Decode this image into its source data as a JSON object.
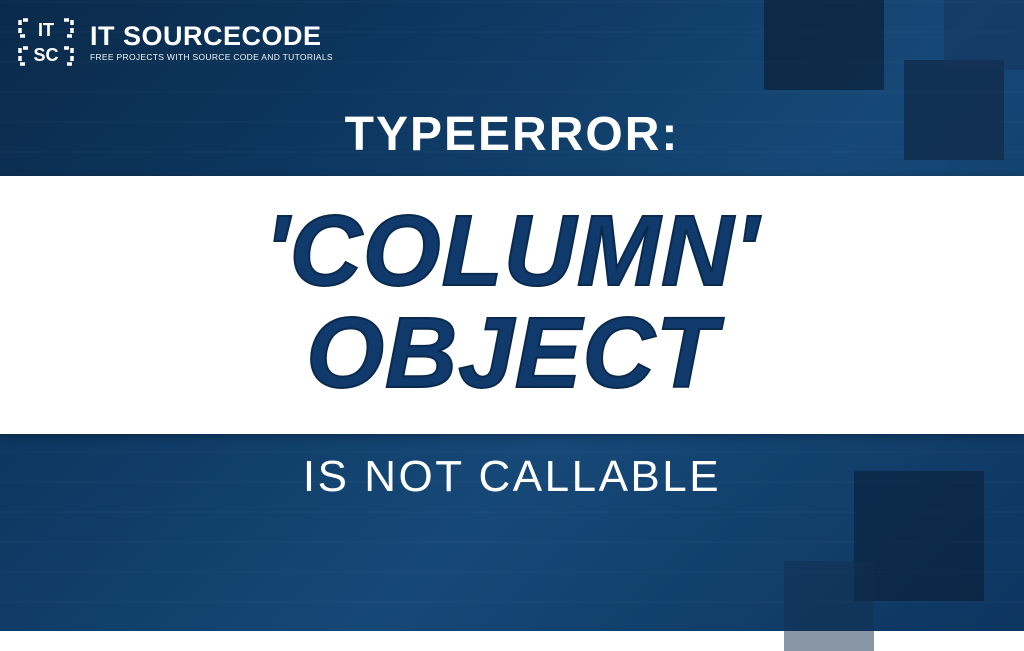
{
  "brand": {
    "name": "IT SOURCECODE",
    "tagline": "FREE PROJECTS WITH SOURCE CODE AND TUTORIALS"
  },
  "title": {
    "top": "TYPEERROR:",
    "main_line1": "'COLUMN'",
    "main_line2": "OBJECT",
    "bottom": "IS NOT CALLABLE"
  },
  "logo": {
    "text_top": "IT",
    "text_bottom": "SC"
  }
}
